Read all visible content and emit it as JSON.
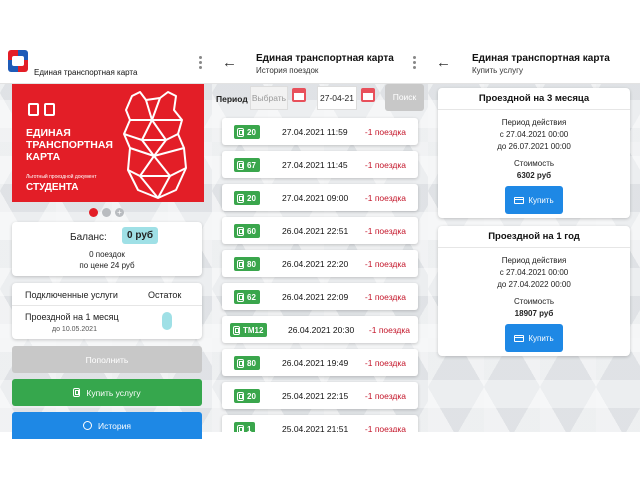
{
  "screen1": {
    "header": {
      "title": "Единая транспортная карта"
    },
    "card": {
      "line1": "ЕДИНАЯ",
      "line2": "ТРАНСПОРТНАЯ",
      "line3": "КАРТА",
      "doc": "Льготный проездной документ",
      "type": "СТУДЕНТА"
    },
    "balance": {
      "label": "Баланс:",
      "value": "0 руб",
      "trips": "0 поездок",
      "price": "по цене 24 руб"
    },
    "services": {
      "col1": "Подключенные услуги",
      "col2": "Остаток",
      "item": "Проездной на 1 месяц",
      "until": "до 10.05.2021"
    },
    "buttons": {
      "topup": "Пополнить",
      "buy": "Купить услугу",
      "history": "История"
    }
  },
  "screen2": {
    "header": {
      "title": "Единая транспортная карта",
      "subtitle": "История поездок"
    },
    "filter": {
      "label": "Период",
      "from_placeholder": "Выбрать",
      "to_value": "27-04-21",
      "search": "Поиск"
    },
    "trips": [
      {
        "route": "20",
        "datetime": "27.04.2021 11:59",
        "count": "-1 поездка"
      },
      {
        "route": "67",
        "datetime": "27.04.2021 11:45",
        "count": "-1 поездка"
      },
      {
        "route": "20",
        "datetime": "27.04.2021 09:00",
        "count": "-1 поездка"
      },
      {
        "route": "60",
        "datetime": "26.04.2021 22:51",
        "count": "-1 поездка"
      },
      {
        "route": "80",
        "datetime": "26.04.2021 22:20",
        "count": "-1 поездка"
      },
      {
        "route": "62",
        "datetime": "26.04.2021 22:09",
        "count": "-1 поездка"
      },
      {
        "route": "ТМ12",
        "datetime": "26.04.2021 20:30",
        "count": "-1 поездка"
      },
      {
        "route": "80",
        "datetime": "26.04.2021 19:49",
        "count": "-1 поездка"
      },
      {
        "route": "20",
        "datetime": "25.04.2021 22:15",
        "count": "-1 поездка"
      },
      {
        "route": "1",
        "datetime": "25.04.2021 21:51",
        "count": "-1 поездка"
      }
    ]
  },
  "screen3": {
    "header": {
      "title": "Единая транспортная карта",
      "subtitle": "Купить услугу"
    },
    "offers": [
      {
        "title": "Проездной на 3 месяца",
        "period_label": "Период действия",
        "from": "с 27.04.2021 00:00",
        "to": "до 26.07.2021 00:00",
        "cost_label": "Стоимость",
        "price": "6302 руб",
        "buy": "Купить"
      },
      {
        "title": "Проездной на 1 год",
        "period_label": "Период действия",
        "from": "с 27.04.2021 00:00",
        "to": "до 27.04.2022 00:00",
        "cost_label": "Стоимость",
        "price": "18907 руб",
        "buy": "Купить"
      }
    ]
  },
  "colors": {
    "brand_red": "#e31e27",
    "route_green": "#3aa64c",
    "trip_red": "#c4162a",
    "buy_blue": "#1e88e5",
    "balance_bg": "#9fe0e6"
  }
}
